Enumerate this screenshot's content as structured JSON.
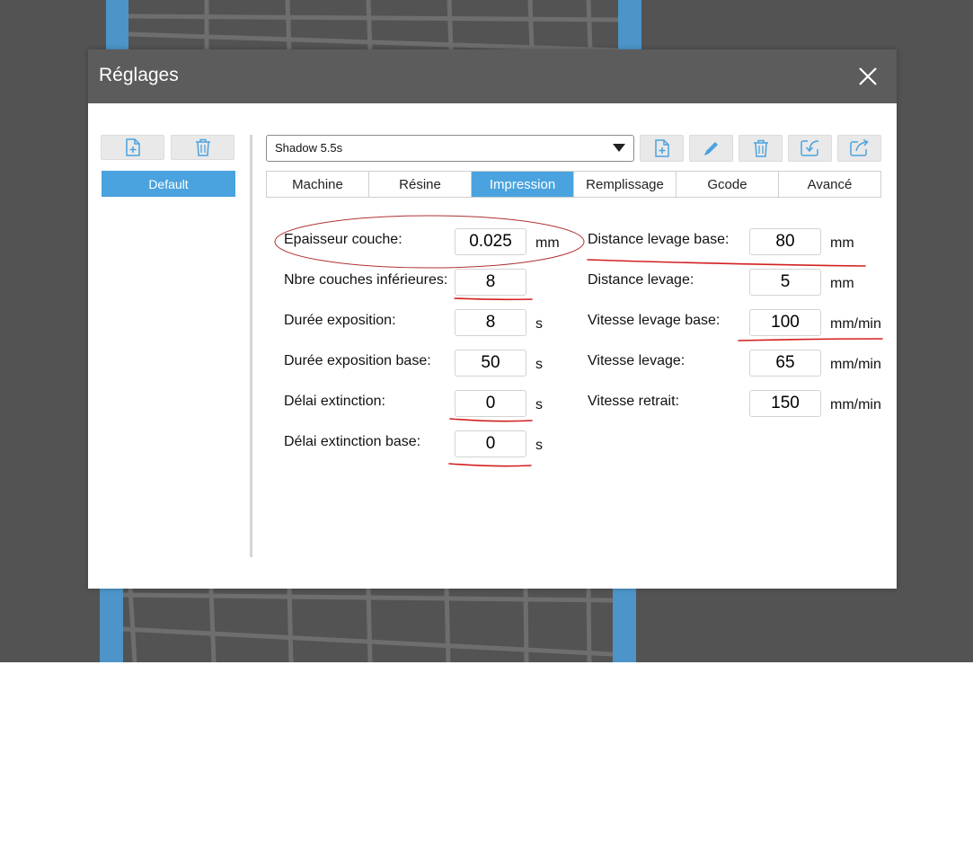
{
  "dialog": {
    "title": "Réglages"
  },
  "profiles": {
    "items": [
      {
        "label": "Default"
      }
    ]
  },
  "preset": {
    "selected": "Shadow 5.5s"
  },
  "tabs": [
    {
      "label": "Machine"
    },
    {
      "label": "Résine"
    },
    {
      "label": "Impression"
    },
    {
      "label": "Remplissage"
    },
    {
      "label": "Gcode"
    },
    {
      "label": "Avancé"
    }
  ],
  "active_tab": "Impression",
  "left_fields": [
    {
      "label": "Epaisseur couche:",
      "value": "0.025",
      "unit": "mm"
    },
    {
      "label": "Nbre couches inférieures:",
      "value": "8",
      "unit": ""
    },
    {
      "label": "Durée exposition:",
      "value": "8",
      "unit": "s"
    },
    {
      "label": "Durée exposition base:",
      "value": "50",
      "unit": "s"
    },
    {
      "label": "Délai extinction:",
      "value": "0",
      "unit": "s"
    },
    {
      "label": "Délai extinction base:",
      "value": "0",
      "unit": "s"
    }
  ],
  "right_fields": [
    {
      "label": "Distance levage base:",
      "value": "80",
      "unit": "mm"
    },
    {
      "label": "Distance levage:",
      "value": "5",
      "unit": "mm"
    },
    {
      "label": "Vitesse levage base:",
      "value": "100",
      "unit": "mm/min"
    },
    {
      "label": "Vitesse levage:",
      "value": "65",
      "unit": "mm/min"
    },
    {
      "label": "Vitesse retrait:",
      "value": "150",
      "unit": "mm/min"
    }
  ],
  "icons": {
    "profile_add": "file-plus-icon",
    "profile_delete": "trash-icon",
    "preset_add": "file-plus-icon",
    "preset_edit": "pencil-icon",
    "preset_delete": "trash-icon",
    "preset_import": "import-icon",
    "preset_export": "export-icon",
    "close": "close-icon"
  },
  "colors": {
    "accent": "#4aa3df",
    "titlebar": "#5c5c5c",
    "viewport": "#535353",
    "annotation": "#d42020"
  }
}
